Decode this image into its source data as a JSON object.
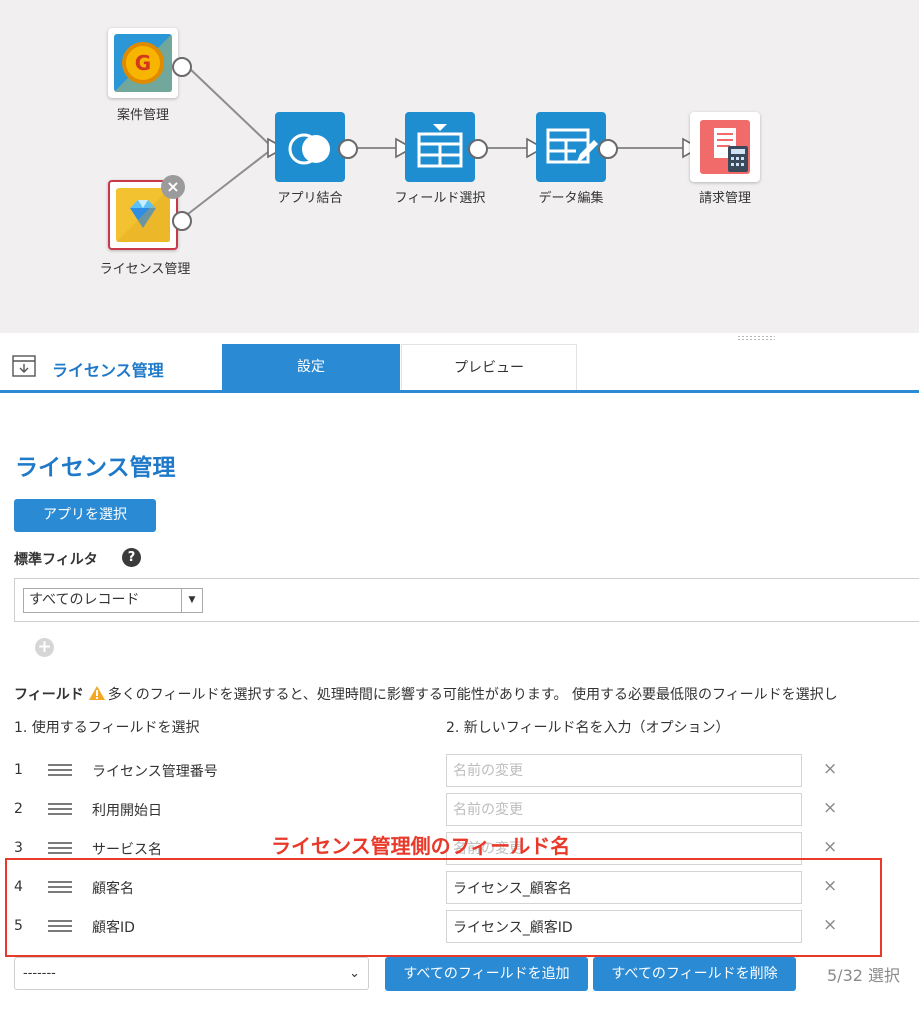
{
  "flow": {
    "nodes": {
      "anken": {
        "label": "案件管理"
      },
      "license": {
        "label": "ライセンス管理"
      },
      "merge": {
        "label": "アプリ結合"
      },
      "field_select": {
        "label": "フィールド選択"
      },
      "data_edit": {
        "label": "データ編集"
      },
      "billing": {
        "label": "請求管理"
      }
    },
    "anken_icon_letter": "G",
    "close_glyph": "×"
  },
  "panel": {
    "title": "ライセンス管理",
    "tabs": {
      "settings": "設定",
      "preview": "プレビュー"
    }
  },
  "settings": {
    "heading": "ライセンス管理",
    "select_app_button": "アプリを選択",
    "standard_filter_label": "標準フィルタ",
    "help_glyph": "?",
    "filter_value": "すべてのレコード",
    "add_glyph": "+",
    "fields_label": "フィールド",
    "fields_warning": "多くのフィールドを選択すると、処理時間に影響する可能性があります。 使用する必要最低限のフィールドを選択し",
    "col1_header": "1. 使用するフィールドを選択",
    "col2_header": "2. 新しいフィールド名を入力（オプション）",
    "rename_placeholder": "名前の変更",
    "remove_glyph": "×",
    "rows": [
      {
        "num": "1",
        "field": "ライセンス管理番号",
        "rename": ""
      },
      {
        "num": "2",
        "field": "利用開始日",
        "rename": ""
      },
      {
        "num": "3",
        "field": "サービス名",
        "rename": ""
      },
      {
        "num": "4",
        "field": "顧客名",
        "rename": "ライセンス_顧客名"
      },
      {
        "num": "5",
        "field": "顧客ID",
        "rename": "ライセンス_顧客ID"
      }
    ],
    "add_field_select": "-------",
    "add_all_button": "すべてのフィールドを追加",
    "remove_all_button": "すべてのフィールドを削除",
    "counter": "5/32 選択"
  },
  "annotation": {
    "text": "ライセンス管理側のフィールド名"
  },
  "colors": {
    "accent": "#2a8ad3",
    "annotation": "#e8392a",
    "title": "#1f79c9"
  }
}
